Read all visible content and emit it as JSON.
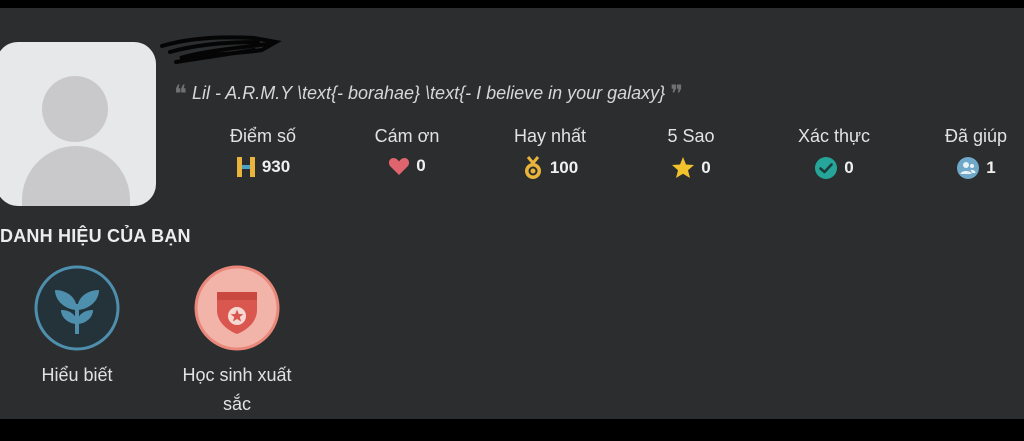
{
  "profile": {
    "quote": "Lil - A.R.M.Y  \\text{- borahae} \\text{- I believe in your galaxy}"
  },
  "stats": [
    {
      "label": "Điểm số",
      "value": "930",
      "icon": "h-points-icon",
      "color": "#e8b43c"
    },
    {
      "label": "Cám ơn",
      "value": "0",
      "icon": "heart-icon",
      "color": "#e0646d"
    },
    {
      "label": "Hay nhất",
      "value": "100",
      "icon": "medal-icon",
      "color": "#e8b43c"
    },
    {
      "label": "5 Sao",
      "value": "0",
      "icon": "star-icon",
      "color": "#f2c12e"
    },
    {
      "label": "Xác thực",
      "value": "0",
      "icon": "verified-check-icon",
      "color": "#26a69a"
    },
    {
      "label": "Đã giúp",
      "value": "1",
      "icon": "users-icon",
      "color": "#6fa8c9"
    }
  ],
  "titles": {
    "heading": "DANH HIỆU CỦA BẠN",
    "badges": [
      {
        "name": "Hiểu biết",
        "icon": "sprout-icon",
        "color": "#4f8fae"
      },
      {
        "name": "Học sinh xuất sắc",
        "icon": "shield-star-icon",
        "color": "#e9877a"
      }
    ]
  }
}
